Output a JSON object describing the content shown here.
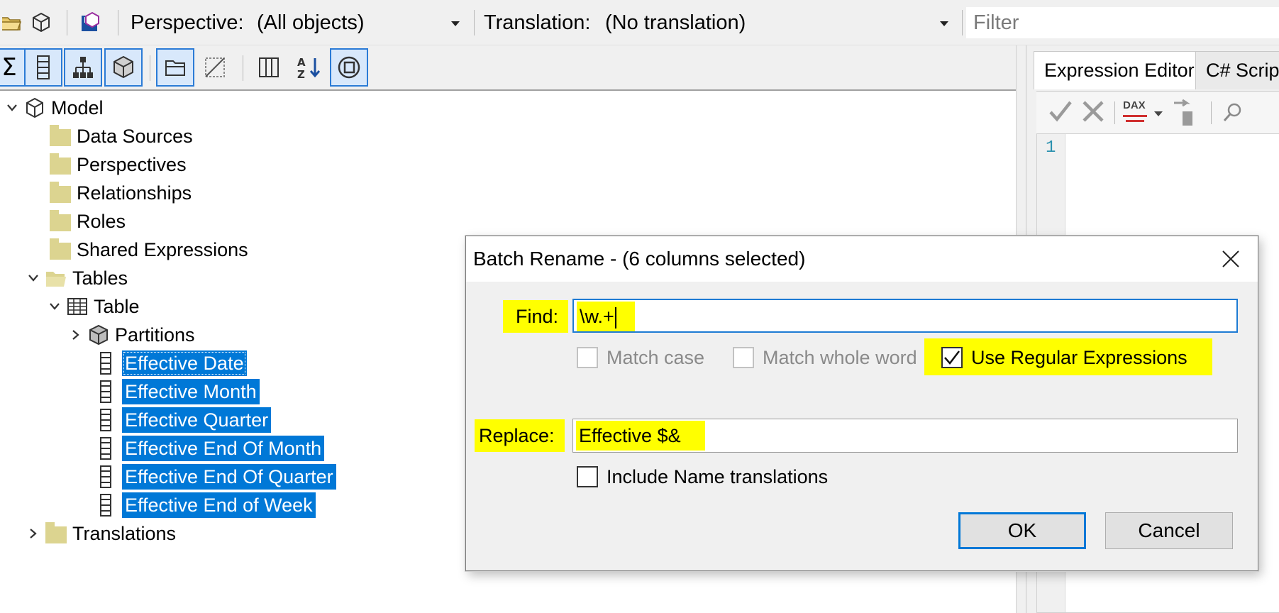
{
  "toolbar": {
    "perspective_label": "Perspective:",
    "perspective_value": "(All objects)",
    "translation_label": "Translation:",
    "translation_value": "(No translation)",
    "filter_placeholder": "Filter"
  },
  "tree": {
    "model": "Model",
    "data_sources": "Data Sources",
    "perspectives": "Perspectives",
    "relationships": "Relationships",
    "roles": "Roles",
    "shared_expressions": "Shared Expressions",
    "tables": "Tables",
    "table": "Table",
    "partitions": "Partitions",
    "columns": [
      "Effective Date",
      "Effective Month",
      "Effective Quarter",
      "Effective End Of Month",
      "Effective End Of Quarter",
      "Effective End of Week"
    ],
    "translations": "Translations"
  },
  "right_panel": {
    "tab_expression": "Expression Editor",
    "tab_csharp": "C# Script",
    "dax_label": "DAX",
    "line_number": "1"
  },
  "dialog": {
    "title": "Batch Rename - (6 columns selected)",
    "find_label": "Find:",
    "find_value": "\\w.+",
    "match_case": "Match case",
    "match_whole_word": "Match whole word",
    "use_regex": "Use Regular Expressions",
    "use_regex_checked": true,
    "replace_label": "Replace:",
    "replace_value": "Effective $&",
    "include_translations": "Include Name translations",
    "ok": "OK",
    "cancel": "Cancel"
  },
  "colors": {
    "selection": "#0078d7",
    "highlight": "#ffff00",
    "folder": "#dcd490",
    "focus_border": "#1e7bd3"
  }
}
